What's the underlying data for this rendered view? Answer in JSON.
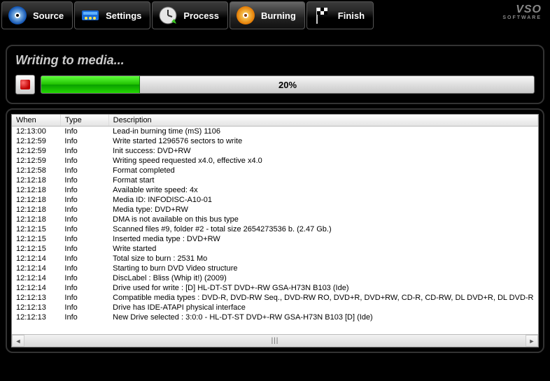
{
  "brand": {
    "line1": "VSO",
    "line2": "SOFTWARE"
  },
  "toolbar": {
    "source": {
      "label": "Source"
    },
    "settings": {
      "label": "Settings"
    },
    "process": {
      "label": "Process"
    },
    "burning": {
      "label": "Burning",
      "active": true
    },
    "finish": {
      "label": "Finish"
    }
  },
  "status": {
    "title": "Writing to media...",
    "progress_percent": 20,
    "progress_text": "20%"
  },
  "log": {
    "columns": {
      "when": "When",
      "type": "Type",
      "description": "Description"
    },
    "rows": [
      {
        "when": "12:13:00",
        "type": "Info",
        "desc": "Lead-in burning time (mS) 1106"
      },
      {
        "when": "12:12:59",
        "type": "Info",
        "desc": "Write started 1296576 sectors to write"
      },
      {
        "when": "12:12:59",
        "type": "Info",
        "desc": "Init success: DVD+RW"
      },
      {
        "when": "12:12:59",
        "type": "Info",
        "desc": "Writing speed requested x4.0, effective x4.0"
      },
      {
        "when": "12:12:58",
        "type": "Info",
        "desc": "Format completed"
      },
      {
        "when": "12:12:18",
        "type": "Info",
        "desc": "Format start"
      },
      {
        "when": "12:12:18",
        "type": "Info",
        "desc": "Available write speed: 4x"
      },
      {
        "when": "12:12:18",
        "type": "Info",
        "desc": "Media ID: INFODISC-A10-01"
      },
      {
        "when": "12:12:18",
        "type": "Info",
        "desc": "Media type: DVD+RW"
      },
      {
        "when": "12:12:18",
        "type": "Info",
        "desc": "DMA is not available on this bus type"
      },
      {
        "when": "12:12:15",
        "type": "Info",
        "desc": "Scanned files #9, folder #2 - total size 2654273536 b. (2.47 Gb.)"
      },
      {
        "when": "12:12:15",
        "type": "Info",
        "desc": "Inserted media type : DVD+RW"
      },
      {
        "when": "12:12:15",
        "type": "Info",
        "desc": "Write started"
      },
      {
        "when": "12:12:14",
        "type": "Info",
        "desc": "Total size to burn : 2531 Mo"
      },
      {
        "when": "12:12:14",
        "type": "Info",
        "desc": "Starting to burn DVD Video structure"
      },
      {
        "when": "12:12:14",
        "type": "Info",
        "desc": "DiscLabel : Bliss (Whip it!) (2009)"
      },
      {
        "when": "12:12:14",
        "type": "Info",
        "desc": "Drive used for write : [D] HL-DT-ST DVD+-RW GSA-H73N B103 (Ide)"
      },
      {
        "when": "12:12:13",
        "type": "Info",
        "desc": "Compatible media types : DVD-R, DVD-RW Seq., DVD-RW RO, DVD+R, DVD+RW, CD-R, CD-RW, DL DVD+R, DL DVD-R"
      },
      {
        "when": "12:12:13",
        "type": "Info",
        "desc": "Drive has IDE-ATAPI physical interface"
      },
      {
        "when": "12:12:13",
        "type": "Info",
        "desc": "New Drive selected : 3:0:0 - HL-DT-ST DVD+-RW GSA-H73N B103 [D] (Ide)"
      }
    ]
  }
}
